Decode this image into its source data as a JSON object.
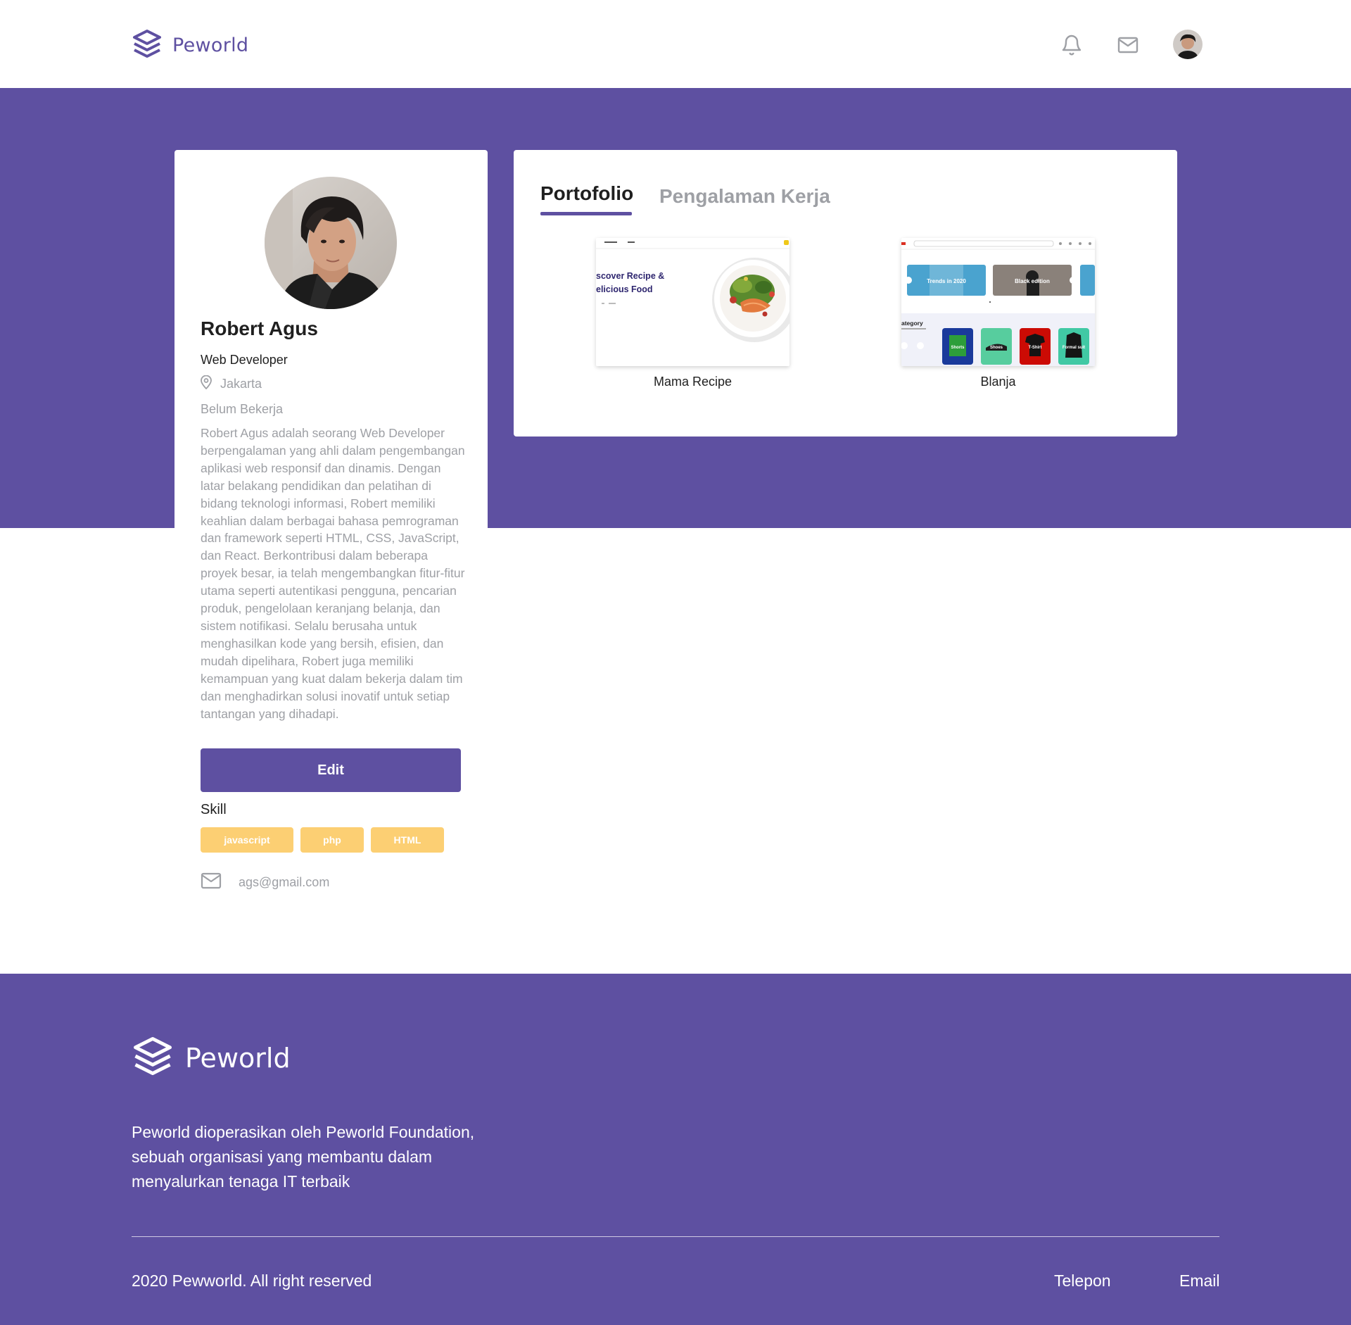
{
  "header": {
    "brand": "Peworld"
  },
  "profile": {
    "name": "Robert Agus",
    "job": "Web Developer",
    "location": "Jakarta",
    "status": "Belum Bekerja",
    "bio": "Robert Agus adalah seorang Web Developer berpengalaman yang ahli dalam pengembangan aplikasi web responsif dan dinamis. Dengan latar belakang pendidikan dan pelatihan di bidang teknologi informasi, Robert memiliki keahlian dalam berbagai bahasa pemrograman dan framework seperti HTML, CSS, JavaScript, dan React. Berkontribusi dalam beberapa proyek besar, ia telah mengembangkan fitur-fitur utama seperti autentikasi pengguna, pencarian produk, pengelolaan keranjang belanja, dan sistem notifikasi. Selalu berusaha untuk menghasilkan kode yang bersih, efisien, dan mudah dipelihara, Robert juga memiliki kemampuan yang kuat dalam bekerja dalam tim dan menghadirkan solusi inovatif untuk setiap tantangan yang dihadapi.",
    "edit_label": "Edit",
    "skill_title": "Skill",
    "skills": [
      "javascript",
      "php",
      "HTML"
    ],
    "email": "ags@gmail.com"
  },
  "tabs": {
    "active": "Portofolio",
    "inactive": "Pengalaman Kerja"
  },
  "portfolio": [
    {
      "label": "Mama Recipe",
      "thumb_text": [
        "scover Recipe &",
        "elicious Food"
      ]
    },
    {
      "label": "Blanja",
      "thumb_text": [
        "Trends in 2020",
        "Black edition",
        "ategory",
        "Shorts",
        "Shoes",
        "T-Shirt",
        "Formal suit"
      ]
    }
  ],
  "footer": {
    "brand": "Peworld",
    "description": "Peworld dioperasikan oleh Peworld Foundation, sebuah organisasi yang membantu dalam menyalurkan tenaga IT terbaik",
    "copyright": "2020 Pewworld. All right reserved",
    "link_phone": "Telepon",
    "link_email": "Email"
  },
  "colors": {
    "primary": "#5e50a1",
    "muted": "#9ea0a5",
    "skill": "#fbb017"
  }
}
